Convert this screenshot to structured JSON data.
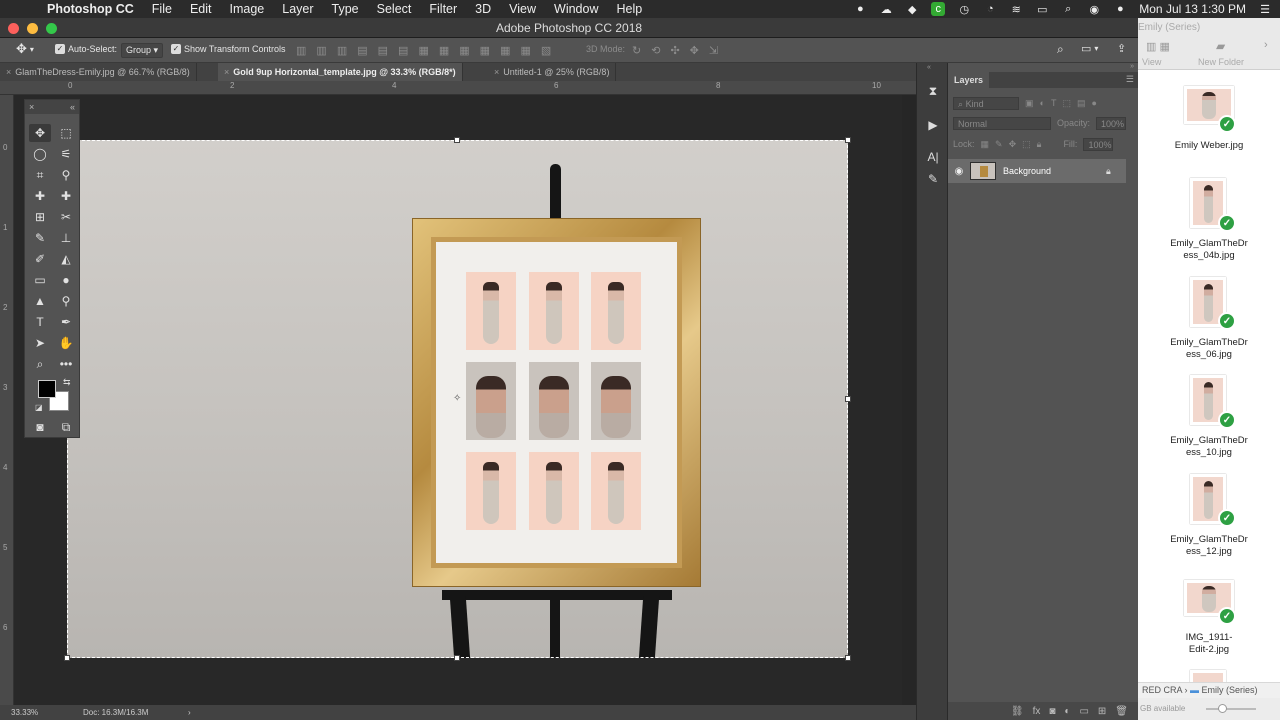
{
  "menubar": {
    "app": "Photoshop CC",
    "items": [
      "File",
      "Edit",
      "Image",
      "Layer",
      "Type",
      "Select",
      "Filter",
      "3D",
      "View",
      "Window",
      "Help"
    ],
    "clock": "Mon Jul 13  1:30 PM"
  },
  "window": {
    "title": "Adobe Photoshop CC 2018"
  },
  "options": {
    "auto_select_label": "Auto-Select:",
    "auto_select_checked": true,
    "group_value": "Group",
    "transform_label": "Show Transform Controls",
    "transform_checked": true,
    "mode_3d_label": "3D Mode:"
  },
  "tabs": [
    {
      "label": "GlamTheDress-Emily.jpg @ 66.7% (RGB/8)",
      "active": false
    },
    {
      "label": "Gold 9up Horizontal_template.jpg @ 33.3% (RGB/8*)",
      "active": true
    },
    {
      "label": "Untitled-1 @ 25% (RGB/8)",
      "active": false
    }
  ],
  "ruler": {
    "h": [
      "0",
      "2",
      "4",
      "6",
      "8",
      "10"
    ],
    "v": [
      "0",
      "1",
      "2",
      "3",
      "4",
      "5",
      "6"
    ]
  },
  "layers": {
    "title": "Layers",
    "filter_placeholder": "Kind",
    "blend_mode": "Normal",
    "opacity_label": "Opacity:",
    "opacity_value": "100%",
    "lock_label": "Lock:",
    "fill_label": "Fill:",
    "fill_value": "100%",
    "items": [
      {
        "name": "Background",
        "locked": true,
        "visible": true
      }
    ]
  },
  "status": {
    "zoom": "33.33%",
    "doc": "Doc: 16.3M/16.3M"
  },
  "finder": {
    "title": "Emily (Series)",
    "view_label": "View",
    "new_folder_label": "New Folder",
    "files": [
      {
        "name": "Emily Weber.jpg"
      },
      {
        "name": "Emily_GlamTheDress_04b.jpg",
        "line1": "Emily_GlamTheDr",
        "line2": "ess_04b.jpg"
      },
      {
        "name": "Emily_GlamTheDress_06.jpg",
        "line1": "Emily_GlamTheDr",
        "line2": "ess_06.jpg"
      },
      {
        "name": "Emily_GlamTheDress_10.jpg",
        "line1": "Emily_GlamTheDr",
        "line2": "ess_10.jpg"
      },
      {
        "name": "Emily_GlamTheDress_12.jpg",
        "line1": "Emily_GlamTheDr",
        "line2": "ess_12.jpg"
      },
      {
        "name": "IMG_1911-Edit-2.jpg",
        "line1": "IMG_1911-",
        "line2": "Edit-2.jpg"
      }
    ],
    "path_prefix": "RED CRA",
    "path_current": "Emily (Series)",
    "storage": "GB available"
  },
  "colors": {
    "accent": "#2ea043",
    "panel_bg": "#535353",
    "canvas_bg": "#282828",
    "frame_gold": "#c39a54"
  }
}
